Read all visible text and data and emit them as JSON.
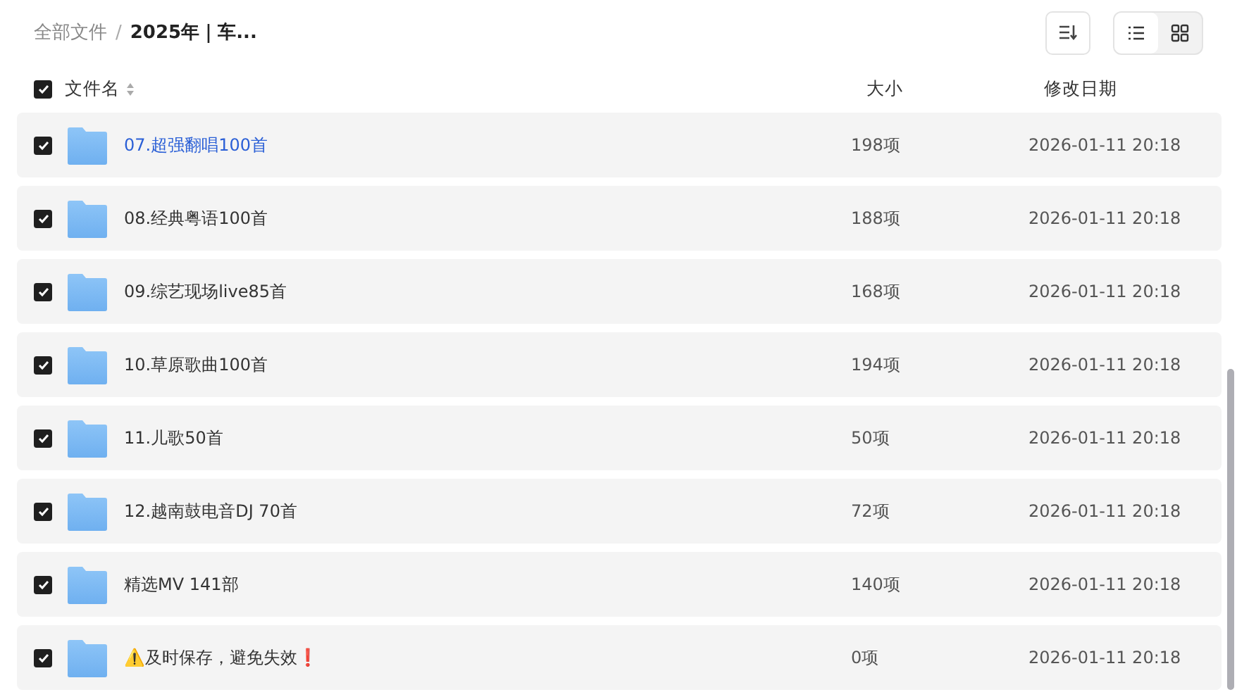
{
  "breadcrumb": [
    {
      "label": "全部文件",
      "current": false
    },
    {
      "label": "2025年｜车...",
      "current": true
    }
  ],
  "separator": "/",
  "view_modes": [
    {
      "kind": "list",
      "selected": true
    },
    {
      "kind": "grid",
      "selected": false
    }
  ],
  "table": {
    "select_all": {
      "checked": true
    },
    "columns": [
      "文件名",
      "大小",
      "修改日期"
    ],
    "rows": [
      {
        "name": "07.超强翻唱100首",
        "size": "198项",
        "modified": "2026-01-11 20:18",
        "checked": true,
        "highlighted": true
      },
      {
        "name": "08.经典粤语100首",
        "size": "188项",
        "modified": "2026-01-11 20:18",
        "checked": true,
        "highlighted": false
      },
      {
        "name": "09.综艺现场live85首",
        "size": "168项",
        "modified": "2026-01-11 20:18",
        "checked": true,
        "highlighted": false
      },
      {
        "name": "10.草原歌曲100首",
        "size": "194项",
        "modified": "2026-01-11 20:18",
        "checked": true,
        "highlighted": false
      },
      {
        "name": "11.儿歌50首",
        "size": "50项",
        "modified": "2026-01-11 20:18",
        "checked": true,
        "highlighted": false
      },
      {
        "name": "12.越南鼓电音DJ 70首",
        "size": "72项",
        "modified": "2026-01-11 20:18",
        "checked": true,
        "highlighted": false
      },
      {
        "name": "精选MV 141部",
        "size": "140项",
        "modified": "2026-01-11 20:18",
        "checked": true,
        "highlighted": false
      },
      {
        "name": "⚠️及时保存，避免失效❗",
        "size": "0项",
        "modified": "2026-01-11 20:18",
        "checked": true,
        "highlighted": false
      }
    ]
  }
}
